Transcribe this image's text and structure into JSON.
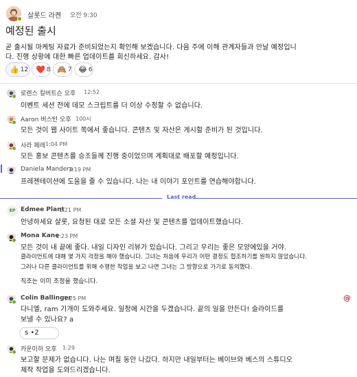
{
  "post": {
    "author": "살롯드 라켄",
    "time": "오전 9:30",
    "title": "예정된 출시",
    "body": [
      "곧 출시될 마케팅 자료가 준비되었는지 확인해 보겠습니다. 다음 주에 이해 관계자들과 만날 예정입니",
      "다. 진행 상황에 대한 빠른 업데이트를 회신하세요. 감사!"
    ],
    "reactions": [
      {
        "emoji": "👍",
        "count": "12",
        "icon": "thumbs-up-icon"
      },
      {
        "emoji": "❤️",
        "count": "8",
        "icon": "heart-icon"
      },
      {
        "emoji": "🙈",
        "count": "7",
        "icon": "monkey-icon"
      },
      {
        "emoji": "😂",
        "count": "6",
        "icon": "laughing-icon"
      }
    ]
  },
  "replies": [
    {
      "name": "로렌스 킬버트슨 오후",
      "time": "12:52",
      "lines": [
        "이벤트 세션 전에 데모 스크립트를 더 이상 수정할 수 없습니다."
      ]
    },
    {
      "name": "Aaron 버스턴 오후",
      "time": "100시",
      "lines": [
        "모든 것이 웹 사이트 쪽에서 좋습니다. 콘텐츠 및 자산은 게시할 준비가 된 것입니다."
      ]
    },
    {
      "name": "사라 페레",
      "time": "1:04 PM",
      "lines": [
        "모든 홍보 콘텐츠를 승조들께 진행 중이었으며 계획대로 배포할 예정입니다."
      ]
    },
    {
      "name": "Daniela Mandera",
      "time": "1:19 PM",
      "lines": [
        "프레젠테이션에 도움을 줄 수 있습니다. 나는 내 이야기 포인트를 연습해야합니다."
      ]
    }
  ],
  "last_read_label": "Last read",
  "new_messages": [
    {
      "name": "Edmee Plant",
      "time": "1:21 PM",
      "avatar_text": "EP",
      "lines": [
        "안녕하세요 샬롯, 요청된 대로 모든 소셜 자산 및 콘텐츠를 업데이트했습니다."
      ]
    },
    {
      "name": "Mona Kane",
      "time": "1:23 PM",
      "lines": [
        "모든 것이 내 끝에 좋다. 내일 디자인 리뷰가 있습니다. 그리고 우리는 좋은 모양에있을 거야.",
        "클라이언트에 대해 몇 가지 걱정을 해야 했습니다. 그녀는 처음에 우리가 어떤 결정도 협조하기를 원하지 않았습니다.",
        "그러나 다른 클라이언트를 위해 수행한 작업을 보고 나면 그녀는 그 방향으로 가기로 동의했다.",
        "",
        "직조는 이미 조정을 했습니다."
      ]
    },
    {
      "name": "Colin Ballinger",
      "time": "1:25 PM",
      "lines": [
        "다니엘, ram 기개이 도와주세요. 일정에 시간을 두겠습니다. 끝의 일을 만든다! 슬라이드를",
        "보낼 수 있나요? a"
      ],
      "mention_icon": "@",
      "reply_pill": "s •2"
    },
    {
      "name": "카운미하 오후",
      "time": "1:29",
      "lines": [
        "보고할 문제가 없습니다. 나는 며칠 동안 나갔다. 하지만 내일부터는 베이브와 베스의 스튜디오",
        "제작 작업을 도와드리겠습니다."
      ]
    }
  ]
}
